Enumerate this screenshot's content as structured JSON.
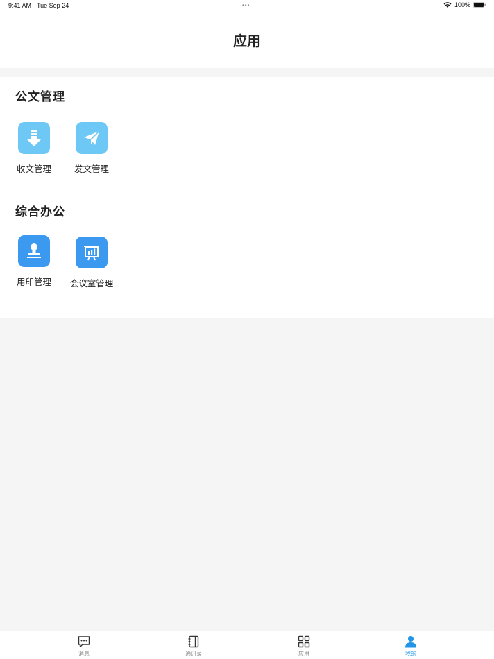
{
  "status_bar": {
    "time": "9:41 AM",
    "date": "Tue Sep 24",
    "dots": "•••",
    "battery": "100%",
    "icons": [
      "wifi-icon",
      "battery-icon"
    ]
  },
  "nav": {
    "title": "应用"
  },
  "sections": [
    {
      "title": "公文管理",
      "apps": [
        {
          "label": "收文管理",
          "icon": "download-arrow-icon",
          "color": "#6ec8f6"
        },
        {
          "label": "发文管理",
          "icon": "paper-plane-icon",
          "color": "#6ec8f6"
        }
      ]
    },
    {
      "title": "综合办公",
      "apps": [
        {
          "label": "用印管理",
          "icon": "stamp-icon",
          "color": "#3b9af0"
        },
        {
          "label": "会议室管理",
          "icon": "presentation-board-icon",
          "color": "#3b9af0"
        }
      ]
    }
  ],
  "tabs": [
    {
      "label": "消息",
      "icon": "message-icon",
      "active": false
    },
    {
      "label": "通讯录",
      "icon": "contacts-book-icon",
      "active": false
    },
    {
      "label": "应用",
      "icon": "grid-icon",
      "active": false
    },
    {
      "label": "我的",
      "icon": "person-icon",
      "active": true
    }
  ],
  "colors": {
    "accent": "#2196e8",
    "icon_light": "#6ec8f6",
    "icon_dark": "#3b9af0",
    "background": "#f5f5f5"
  }
}
